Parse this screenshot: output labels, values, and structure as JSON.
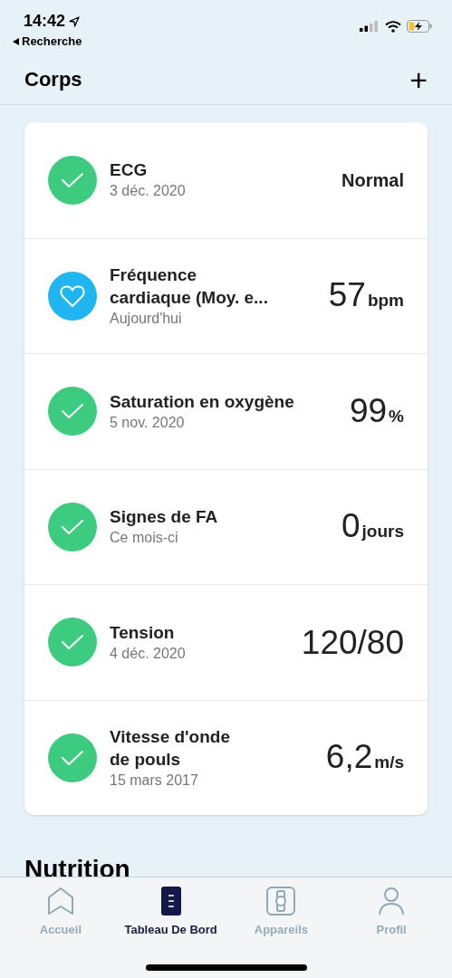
{
  "status_bar": {
    "time": "14:42",
    "back_label": "Recherche"
  },
  "header": {
    "title": "Corps",
    "add_symbol": "+"
  },
  "metrics": [
    {
      "kind": "check",
      "title_lines": [
        "ECG"
      ],
      "subtitle": "3 déc. 2020",
      "value": {
        "kind": "text",
        "text": "Normal"
      }
    },
    {
      "kind": "heart",
      "title_lines": [
        "Fréquence",
        "cardiaque (Moy. e..."
      ],
      "subtitle": "Aujourd'hui",
      "value": {
        "kind": "number",
        "text": "57",
        "unit": "bpm"
      }
    },
    {
      "kind": "check",
      "title_lines": [
        "Saturation en oxygène"
      ],
      "subtitle": "5 nov. 2020",
      "value": {
        "kind": "number",
        "text": "99",
        "unit": "%"
      }
    },
    {
      "kind": "check",
      "title_lines": [
        "Signes de FA"
      ],
      "subtitle": "Ce mois-ci",
      "value": {
        "kind": "number",
        "text": "0",
        "unit": "jours"
      }
    },
    {
      "kind": "check",
      "title_lines": [
        "Tension"
      ],
      "subtitle": "4 déc. 2020",
      "value": {
        "kind": "number",
        "text": "120/80"
      }
    },
    {
      "kind": "check",
      "title_lines": [
        "Vitesse d'onde",
        "de pouls"
      ],
      "subtitle": "15 mars 2017",
      "value": {
        "kind": "number",
        "text": "6,2",
        "unit": "m/s"
      }
    }
  ],
  "next_section": {
    "title": "Nutrition"
  },
  "tabs": [
    {
      "kind": "home",
      "label": "Accueil",
      "selected": false
    },
    {
      "kind": "dashboard",
      "label": "Tableau De Bord",
      "selected": true
    },
    {
      "kind": "watch",
      "label": "Appareils",
      "selected": false
    },
    {
      "kind": "profile",
      "label": "Profil",
      "selected": false
    }
  ]
}
